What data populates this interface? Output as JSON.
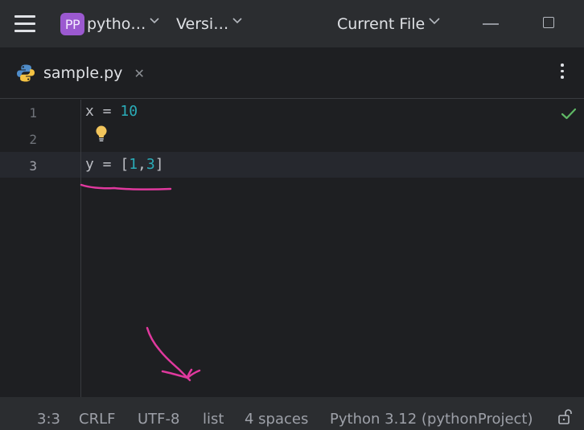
{
  "titlebar": {
    "project_badge": "PP",
    "project_name": "pytho…",
    "vcs_label": "Versi…",
    "run_config": "Current File"
  },
  "tab": {
    "filename": "sample.py",
    "close_glyph": "✕",
    "icon": "python-icon"
  },
  "editor": {
    "line_numbers": [
      "1",
      "2",
      "3"
    ],
    "lines": [
      {
        "text": "x = ",
        "number": "10"
      },
      {
        "text": ""
      },
      {
        "text": "y = [",
        "n1": "1",
        "sep": ",",
        "n2": "3",
        "close": "]"
      }
    ],
    "intention_icon": "lightbulb-icon",
    "inspection_icon": "checkmark-icon"
  },
  "statusbar": {
    "position": "3:3",
    "line_separator": "CRLF",
    "encoding": "UTF-8",
    "type_hint": "list",
    "indent": "4 spaces",
    "interpreter": "Python 3.12 (pythonProject)",
    "lock_icon": "unlock-icon"
  },
  "colors": {
    "accent_badge": "#9b59d0",
    "number_literal": "#2aacb8",
    "annotation": "#e0399e",
    "check": "#5fb865"
  }
}
